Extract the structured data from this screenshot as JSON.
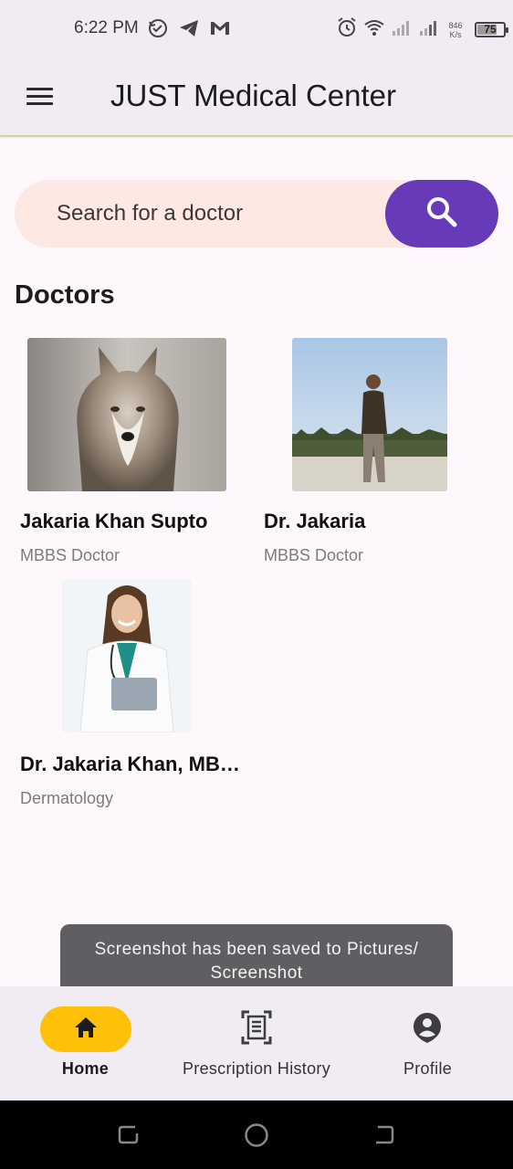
{
  "status_bar": {
    "time": "6:22 PM",
    "net_speed_value": "846",
    "net_speed_unit": "K/s",
    "battery_level": "75",
    "icons_left": [
      "sync-check-icon",
      "telegram-icon",
      "gmail-icon"
    ],
    "icons_right": [
      "alarm-icon",
      "wifi-icon",
      "signal-icon",
      "signal-icon"
    ]
  },
  "app_bar": {
    "title": "JUST Medical Center"
  },
  "search": {
    "placeholder": "Search for a doctor"
  },
  "doctors_section": {
    "title": "Doctors",
    "items": [
      {
        "name": "Jakaria Khan Supto",
        "specialty": "MBBS Doctor",
        "photo": "wolf-photo"
      },
      {
        "name": "Dr. Jakaria",
        "specialty": "MBBS Doctor",
        "photo": "man-on-beach-photo"
      },
      {
        "name": "Dr. Jakaria Khan, MB…",
        "specialty": "Dermatology",
        "photo": "female-doctor-photo"
      }
    ]
  },
  "toast": {
    "line1": "Screenshot has been saved to  Pictures/",
    "line2": "Screenshot"
  },
  "bottom_nav": {
    "items": [
      {
        "label": "Home",
        "icon": "home-icon",
        "active": true
      },
      {
        "label": "Prescription History",
        "icon": "document-scan-icon",
        "active": false
      },
      {
        "label": "Profile",
        "icon": "account-circle-icon",
        "active": false
      }
    ]
  },
  "colors": {
    "primary": "#673ab7",
    "active_pill": "#ffc107",
    "search_bg": "#fde8e4",
    "surface": "#f1ebf4",
    "background": "#fef7fc"
  }
}
